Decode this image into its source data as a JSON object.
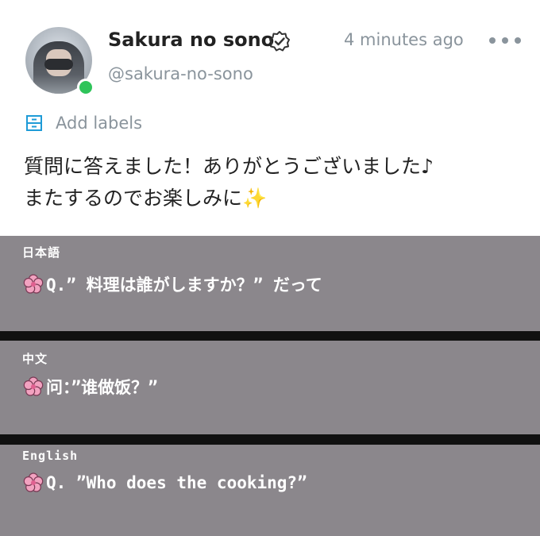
{
  "post": {
    "display_name": "Sakura no sono",
    "handle": "@sakura-no-sono",
    "timestamp": "4 minutes ago",
    "add_labels": "Add labels",
    "text_line1": "質問に答えました！ありがとうございました♪",
    "text_line2": "またするのでお楽しみに",
    "text_emoji": "✨"
  },
  "image_panels": [
    {
      "lang": "日本語",
      "text": "Q.” 料理は誰がしますか？” だって"
    },
    {
      "lang": "中文",
      "text": "问：”谁做饭？”"
    },
    {
      "lang": "English",
      "text": "Q. ”Who does the cooking?”"
    }
  ],
  "colors": {
    "accent_blue": "#1e9bd7",
    "online_green": "#2fc45a",
    "muted_text": "#8a949c",
    "panel_gray": "#8b878c",
    "flower_pink": "#f2a2c0"
  },
  "icons": [
    "verified-badge-icon",
    "more-options-icon",
    "labels-icon",
    "sakura-flower-icon"
  ]
}
